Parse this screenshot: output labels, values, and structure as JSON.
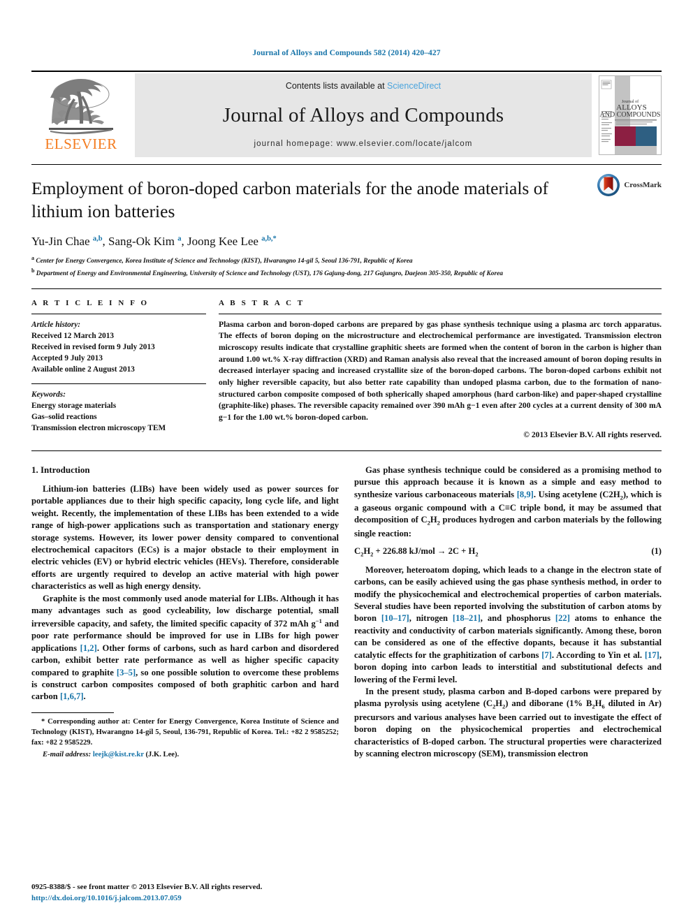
{
  "running_head": "Journal of Alloys and Compounds 582 (2014) 420–427",
  "masthead": {
    "publisher_name": "ELSEVIER",
    "contents_prefix": "Contents lists available at",
    "sciencedirect": "ScienceDirect",
    "journal_title": "Journal of Alloys and Compounds",
    "homepage": "journal homepage: www.elsevier.com/locate/jalcom",
    "cover_title_line1": "Journal of",
    "cover_title_line2": "ALLOYS",
    "cover_title_line3": "AND COMPOUNDS",
    "cover_colors": {
      "maroon": "#8c1f42",
      "navy": "#2e5f82",
      "gray": "#c3c3c3"
    }
  },
  "article": {
    "title": "Employment of boron-doped carbon materials for the anode materials of lithium ion batteries",
    "crossmark_label": "CrossMark",
    "authors_html": "Yu-Jin Chae <sup>a,b</sup>, Sang-Ok Kim <sup>a</sup>, Joong Kee Lee <sup>a,b,*</sup>",
    "affiliation_a": "Center for Energy Convergence, Korea Institute of Science and Technology (KIST), Hwarangno 14-gil 5, Seoul 136-791, Republic of Korea",
    "affiliation_b": "Department of Energy and Environmental Engineering, University of Science and Technology (UST), 176 Gajung-dong, 217 Gajungro, Daejeon 305-350, Republic of Korea"
  },
  "article_info": {
    "heading": "A R T I C L E    I N F O",
    "history_label": "Article history:",
    "history": [
      "Received 12 March 2013",
      "Received in revised form 9 July 2013",
      "Accepted 9 July 2013",
      "Available online 2 August 2013"
    ],
    "keywords_label": "Keywords:",
    "keywords": [
      "Energy storage materials",
      "Gas–solid reactions",
      "Transmission electron microscopy TEM"
    ]
  },
  "abstract": {
    "heading": "A B S T R A C T",
    "text": "Plasma carbon and boron-doped carbons are prepared by gas phase synthesis technique using a plasma arc torch apparatus. The effects of boron doping on the microstructure and electrochemical performance are investigated. Transmission electron microscopy results indicate that crystalline graphitic sheets are formed when the content of boron in the carbon is higher than around 1.00 wt.% X-ray diffraction (XRD) and Raman analysis also reveal that the increased amount of boron doping results in decreased interlayer spacing and increased crystallite size of the boron-doped carbons. The boron-doped carbons exhibit not only higher reversible capacity, but also better rate capability than undoped plasma carbon, due to the formation of nano-structured carbon composite composed of both spherically shaped amorphous (hard carbon-like) and paper-shaped crystalline (graphite-like) phases. The reversible capacity remained over 390 mAh g−1 even after 200 cycles at a current density of 300 mA g−1 for the 1.00 wt.% boron-doped carbon.",
    "copyright": "© 2013 Elsevier B.V. All rights reserved."
  },
  "intro": {
    "heading": "1. Introduction",
    "p1": "Lithium-ion batteries (LIBs) have been widely used as power sources for portable appliances due to their high specific capacity, long cycle life, and light weight. Recently, the implementation of these LIBs has been extended to a wide range of high-power applications such as transportation and stationary energy storage systems. However, its lower power density compared to conventional electrochemical capacitors (ECs) is a major obstacle to their employment in electric vehicles (EV) or hybrid electric vehicles (HEVs). Therefore, considerable efforts are urgently required to develop an active material with high power characteristics as well as high energy density.",
    "p2_a": "Graphite is the most commonly used anode material for LIBs. Although it has many advantages such as good cycleability, low discharge potential, small irreversible capacity, and safety, the limited specific capacity of 372 mAh g",
    "p2_b": " and poor rate performance should be improved for use in LIBs for high power applications ",
    "p2_ref1": "[1,2]",
    "p2_c": ". Other forms of carbons, such as hard carbon and disordered carbon, exhibit better rate performance as well as higher specific capacity compared to graphite ",
    "p2_ref2": "[3–5]",
    "p2_d": ", so one possible solution to overcome these problems is construct carbon composites composed of both graphitic carbon and hard carbon ",
    "p2_ref3": "[1,6,7]",
    "p2_e": "."
  },
  "right_column": {
    "p3_a": "Gas phase synthesis technique could be considered as a promising method to pursue this approach because it is known as a simple and easy method to synthesize various carbonaceous materials ",
    "p3_ref1": "[8,9]",
    "p3_b": ". Using acetylene (C",
    "p3_c": "), which is a gaseous organic compound with a C≡C triple bond, it may be assumed that decomposition of C",
    "p3_d": " produces hydrogen and carbon materials by the following single reaction:",
    "equation_text": "C2H2 + 226.88 kJ/mol → 2C + H2",
    "equation_number": "(1)",
    "p4_a": "Moreover, heteroatom doping, which leads to a change in the electron state of carbons, can be easily achieved using the gas phase synthesis method, in order to modify the physicochemical and electrochemical properties of carbon materials. Several studies have been reported involving the substitution of carbon atoms by boron ",
    "p4_ref1": "[10–17]",
    "p4_b": ", nitrogen ",
    "p4_ref2": "[18–21]",
    "p4_c": ", and phosphorus ",
    "p4_ref3": "[22]",
    "p4_d": " atoms to enhance the reactivity and conductivity of carbon materials significantly. Among these, boron can be considered as one of the effective dopants, because it has substantial catalytic effects for the graphitization of carbons ",
    "p4_ref4": "[7]",
    "p4_e": ". According to Yin et al. ",
    "p4_ref5": "[17]",
    "p4_f": ", boron doping into carbon leads to interstitial and substitutional defects and lowering of the Fermi level.",
    "p5_a": "In the present study, plasma carbon and B-doped carbons were prepared by plasma pyrolysis using acetylene (C",
    "p5_b": ") and diborane (1% B",
    "p5_c": " diluted in Ar) precursors and various analyses have been carried out to investigate the effect of boron doping on the physicochemical properties and electrochemical characteristics of B-doped carbon. The structural properties were characterized by scanning electron microscopy (SEM), transmission electron"
  },
  "footnote": {
    "corresponding": "* Corresponding author at: Center for Energy Convergence, Korea Institute of Science and Technology (KIST), Hwarangno 14-gil 5, Seoul, 136-791, Republic of Korea. Tel.: +82 2 9585252; fax: +82 2 9585229.",
    "email_label": "E-mail address:",
    "email": "leejk@kist.re.kr",
    "email_owner": "(J.K. Lee)."
  },
  "colophon": {
    "issn_line": "0925-8388/$ - see front matter © 2013 Elsevier B.V. All rights reserved.",
    "doi": "http://dx.doi.org/10.1016/j.jalcom.2013.07.059"
  },
  "colors": {
    "link": "#1573a8",
    "sciencedirect": "#4aa4dd",
    "elsevier_orange": "#f47c20",
    "panel_gray": "#e6e6e6"
  }
}
